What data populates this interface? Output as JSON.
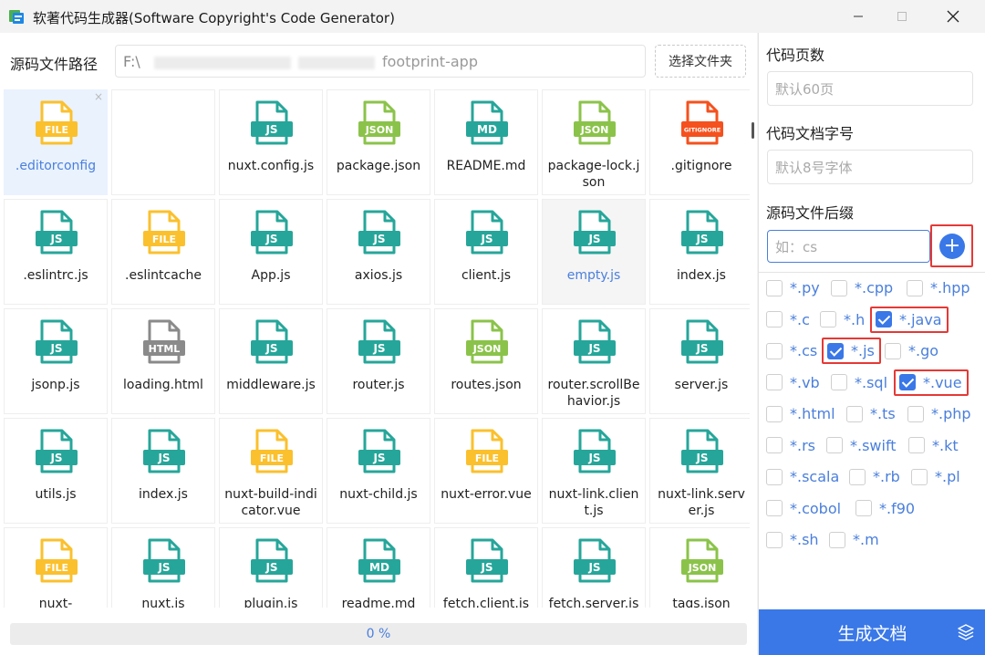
{
  "window": {
    "title": "软著代码生成器(Software Copyright's Code Generator)"
  },
  "path": {
    "label": "源码文件路径",
    "prefix": "F:\\",
    "suffix": "footprint-app",
    "choose_label": "选择文件夹"
  },
  "files": [
    {
      "name": ".editorconfig",
      "type": "FILE",
      "color": "#fbc02d",
      "state": "selected"
    },
    {
      "name": "",
      "type": "",
      "color": "",
      "state": "empty"
    },
    {
      "name": "nuxt.config.js",
      "type": "JS",
      "color": "#26a69a"
    },
    {
      "name": "package.json",
      "type": "JSON",
      "color": "#8bc34a"
    },
    {
      "name": "README.md",
      "type": "MD",
      "color": "#26a69a"
    },
    {
      "name": "package-lock.json",
      "type": "JSON",
      "color": "#8bc34a"
    },
    {
      "name": ".gitignore",
      "type": "GITIGNORE",
      "color": "#f4511e"
    },
    {
      "name": ".eslintrc.js",
      "type": "JS",
      "color": "#26a69a"
    },
    {
      "name": ".eslintcache",
      "type": "FILE",
      "color": "#fbc02d"
    },
    {
      "name": "App.js",
      "type": "JS",
      "color": "#26a69a"
    },
    {
      "name": "axios.js",
      "type": "JS",
      "color": "#26a69a"
    },
    {
      "name": "client.js",
      "type": "JS",
      "color": "#26a69a"
    },
    {
      "name": "empty.js",
      "type": "JS",
      "color": "#26a69a",
      "state": "hovered"
    },
    {
      "name": "index.js",
      "type": "JS",
      "color": "#26a69a"
    },
    {
      "name": "jsonp.js",
      "type": "JS",
      "color": "#26a69a"
    },
    {
      "name": "loading.html",
      "type": "HTML",
      "color": "#8a8a8a"
    },
    {
      "name": "middleware.js",
      "type": "JS",
      "color": "#26a69a"
    },
    {
      "name": "router.js",
      "type": "JS",
      "color": "#26a69a"
    },
    {
      "name": "routes.json",
      "type": "JSON",
      "color": "#8bc34a"
    },
    {
      "name": "router.scrollBehavior.js",
      "type": "JS",
      "color": "#26a69a"
    },
    {
      "name": "server.js",
      "type": "JS",
      "color": "#26a69a"
    },
    {
      "name": "utils.js",
      "type": "JS",
      "color": "#26a69a"
    },
    {
      "name": "index.js",
      "type": "JS",
      "color": "#26a69a"
    },
    {
      "name": "nuxt-build-indicator.vue",
      "type": "FILE",
      "color": "#fbc02d"
    },
    {
      "name": "nuxt-child.js",
      "type": "JS",
      "color": "#26a69a"
    },
    {
      "name": "nuxt-error.vue",
      "type": "FILE",
      "color": "#fbc02d"
    },
    {
      "name": "nuxt-link.client.js",
      "type": "JS",
      "color": "#26a69a"
    },
    {
      "name": "nuxt-link.server.js",
      "type": "JS",
      "color": "#26a69a"
    },
    {
      "name": "nuxt-",
      "type": "FILE",
      "color": "#fbc02d"
    },
    {
      "name": "nuxt.js",
      "type": "JS",
      "color": "#26a69a"
    },
    {
      "name": "plugin.js",
      "type": "JS",
      "color": "#26a69a"
    },
    {
      "name": "readme.md",
      "type": "MD",
      "color": "#26a69a"
    },
    {
      "name": "fetch.client.js",
      "type": "JS",
      "color": "#26a69a"
    },
    {
      "name": "fetch.server.js",
      "type": "JS",
      "color": "#26a69a"
    },
    {
      "name": "tags.json",
      "type": "JSON",
      "color": "#8bc34a"
    }
  ],
  "progress": {
    "text": "0 %"
  },
  "settings": {
    "pages_label": "代码页数",
    "pages_placeholder": "默认60页",
    "font_label": "代码文档字号",
    "font_placeholder": "默认8号字体",
    "suffix_label": "源码文件后缀",
    "suffix_placeholder": "如：cs"
  },
  "extensions": [
    [
      {
        "label": "*.py",
        "checked": false
      },
      {
        "label": "*.cpp",
        "checked": false
      },
      {
        "label": "*.hpp",
        "checked": false
      }
    ],
    [
      {
        "label": "*.c",
        "checked": false
      },
      {
        "label": "*.h",
        "checked": false
      },
      {
        "label": "*.java",
        "checked": true,
        "highlight": true
      }
    ],
    [
      {
        "label": "*.cs",
        "checked": false
      },
      {
        "label": "*.js",
        "checked": true,
        "highlight": true
      },
      {
        "label": "*.go",
        "checked": false
      }
    ],
    [
      {
        "label": "*.vb",
        "checked": false
      },
      {
        "label": "*.sql",
        "checked": false
      },
      {
        "label": "*.vue",
        "checked": true,
        "highlight": true
      }
    ],
    [
      {
        "label": "*.html",
        "checked": false
      },
      {
        "label": "*.ts",
        "checked": false
      },
      {
        "label": "*.php",
        "checked": false
      }
    ],
    [
      {
        "label": "*.rs",
        "checked": false
      },
      {
        "label": "*.swift",
        "checked": false
      },
      {
        "label": "*.kt",
        "checked": false
      }
    ],
    [
      {
        "label": "*.scala",
        "checked": false
      },
      {
        "label": "*.rb",
        "checked": false
      },
      {
        "label": "*.pl",
        "checked": false
      }
    ],
    [
      {
        "label": "*.cobol",
        "checked": false
      },
      {
        "label": "*.f90",
        "checked": false
      }
    ],
    [
      {
        "label": "*.sh",
        "checked": false
      },
      {
        "label": "*.m",
        "checked": false
      }
    ]
  ],
  "generate": {
    "label": "生成文档"
  },
  "colors": {
    "accent": "#3a78e8",
    "highlight": "#e53935",
    "link": "#4a7fdc"
  }
}
